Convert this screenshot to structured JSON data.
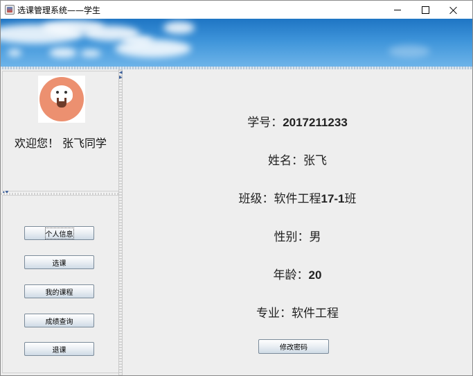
{
  "window": {
    "title": "选课管理系统——学生",
    "icon": "java-cup-icon",
    "controls": [
      "minimize-icon",
      "maximize-icon",
      "close-icon"
    ]
  },
  "banner": {
    "image": "sky-clouds"
  },
  "sidebar": {
    "avatar": "cartoon-avatar",
    "welcome": "欢迎您！ 张飞同学",
    "buttons": [
      {
        "label": "个人信息",
        "focused": true
      },
      {
        "label": "选课"
      },
      {
        "label": "我的课程"
      },
      {
        "label": "成绩查询"
      },
      {
        "label": "退课"
      }
    ]
  },
  "profile": {
    "student_id": {
      "label": "学号：",
      "value": "2017211233"
    },
    "name": {
      "label": "姓名：",
      "value": "张飞"
    },
    "class": {
      "label": "班级：",
      "value_prefix": "软件工程",
      "value_num": "17-1",
      "value_suffix": "班"
    },
    "gender": {
      "label": "性别：",
      "value": "男"
    },
    "age": {
      "label": "年龄：",
      "value": "20"
    },
    "major": {
      "label": "专业：",
      "value": "软件工程"
    },
    "change_password": "修改密码"
  }
}
